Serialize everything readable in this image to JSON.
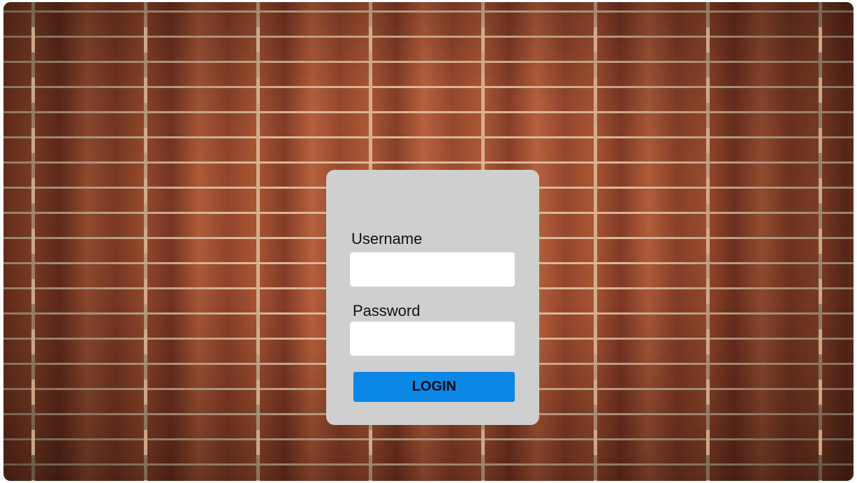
{
  "background": {
    "type": "brick-wall",
    "colors": {
      "brick": "#8c4028",
      "mortar": "#d9b79a"
    }
  },
  "login_form": {
    "username_label": "Username",
    "username_value": "",
    "password_label": "Password",
    "password_value": "",
    "login_button_label": "LOGIN",
    "colors": {
      "card": "#cfcfcf",
      "button": "#0b87e6",
      "input": "#ffffff"
    }
  }
}
